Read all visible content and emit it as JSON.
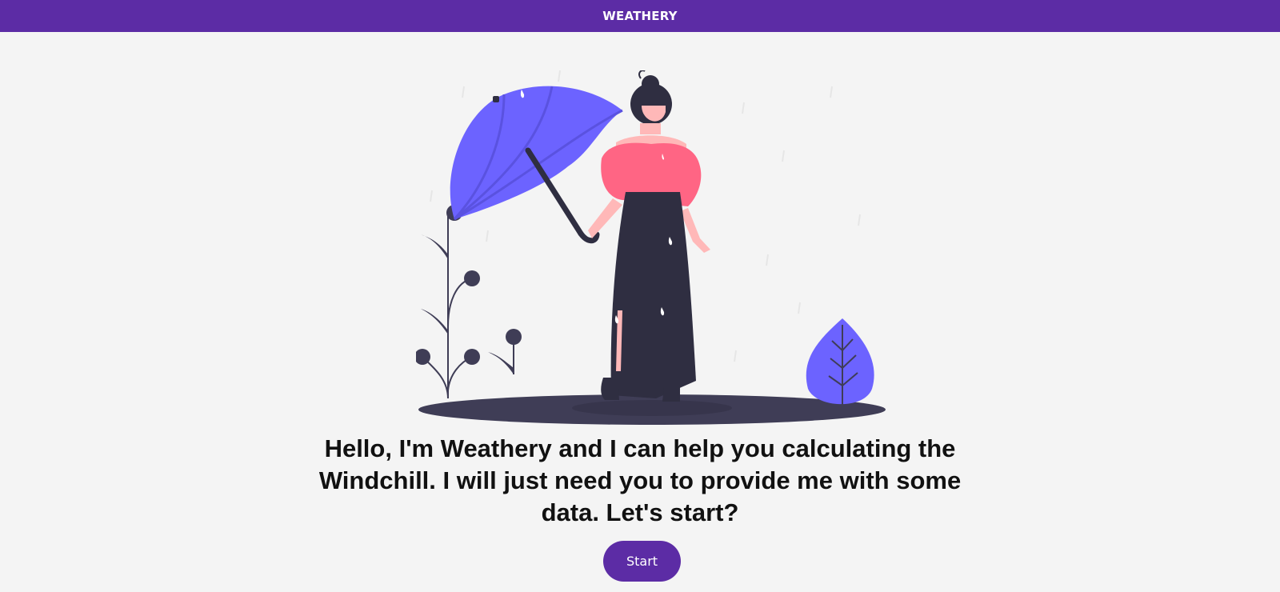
{
  "header": {
    "title": "WEATHERY"
  },
  "illustration": {
    "icon": "woman-with-umbrella-illustration",
    "colors": {
      "umbrella": "#6c63ff",
      "top": "#ff6584",
      "skirt": "#2f2e41",
      "ground": "#3f3d56",
      "skin": "#ffb8b8"
    }
  },
  "main": {
    "intro_text": "Hello, I'm Weathery and I can help you calculating the Windchill. I will just need you to provide me with some data. Let's start?",
    "start_label": "Start"
  },
  "theme": {
    "accent": "#5c2ca5",
    "background": "#f4f4f4"
  }
}
